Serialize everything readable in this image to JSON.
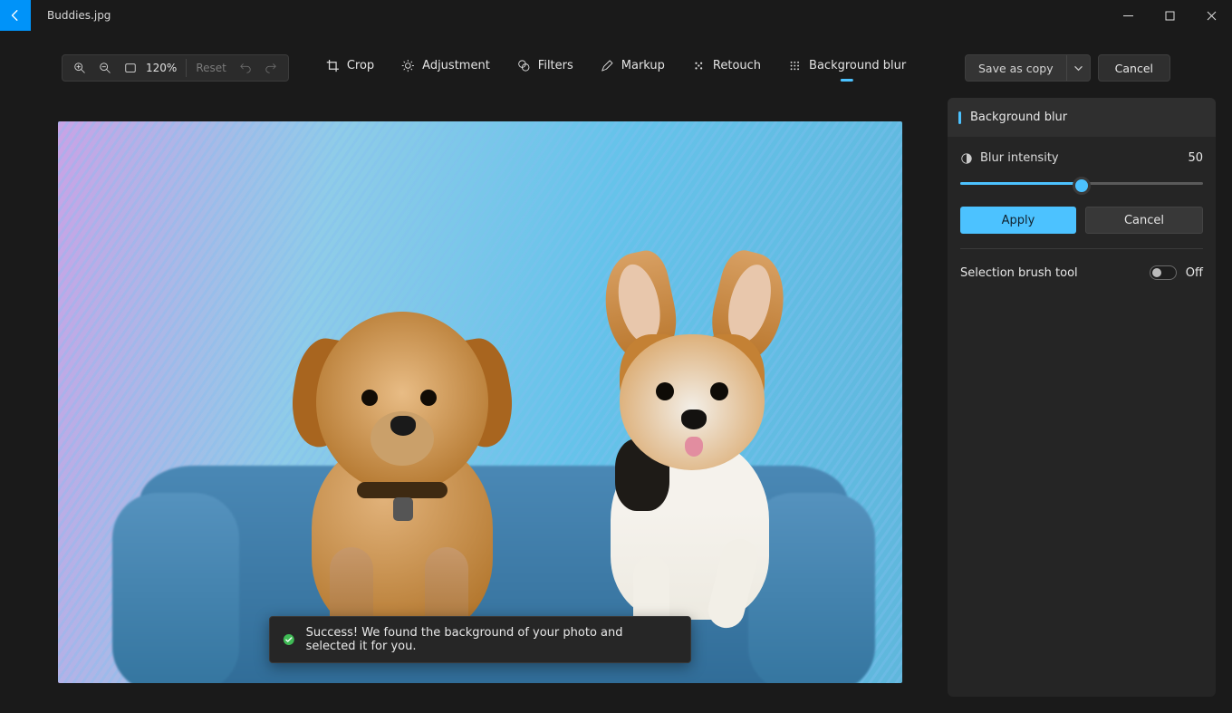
{
  "titlebar": {
    "filename": "Buddies.jpg"
  },
  "toolbar": {
    "zoom_level": "120%",
    "reset": "Reset"
  },
  "tabs": {
    "crop": "Crop",
    "adjustment": "Adjustment",
    "filters": "Filters",
    "markup": "Markup",
    "retouch": "Retouch",
    "bgblur": "Background blur"
  },
  "actions": {
    "save_as_copy": "Save as copy",
    "cancel": "Cancel"
  },
  "toast": {
    "message": "Success! We found the background of your photo and selected it for you."
  },
  "panel": {
    "title": "Background blur",
    "blur_label": "Blur intensity",
    "blur_value": "50",
    "apply": "Apply",
    "cancel": "Cancel",
    "brush_label": "Selection brush tool",
    "brush_state": "Off"
  }
}
